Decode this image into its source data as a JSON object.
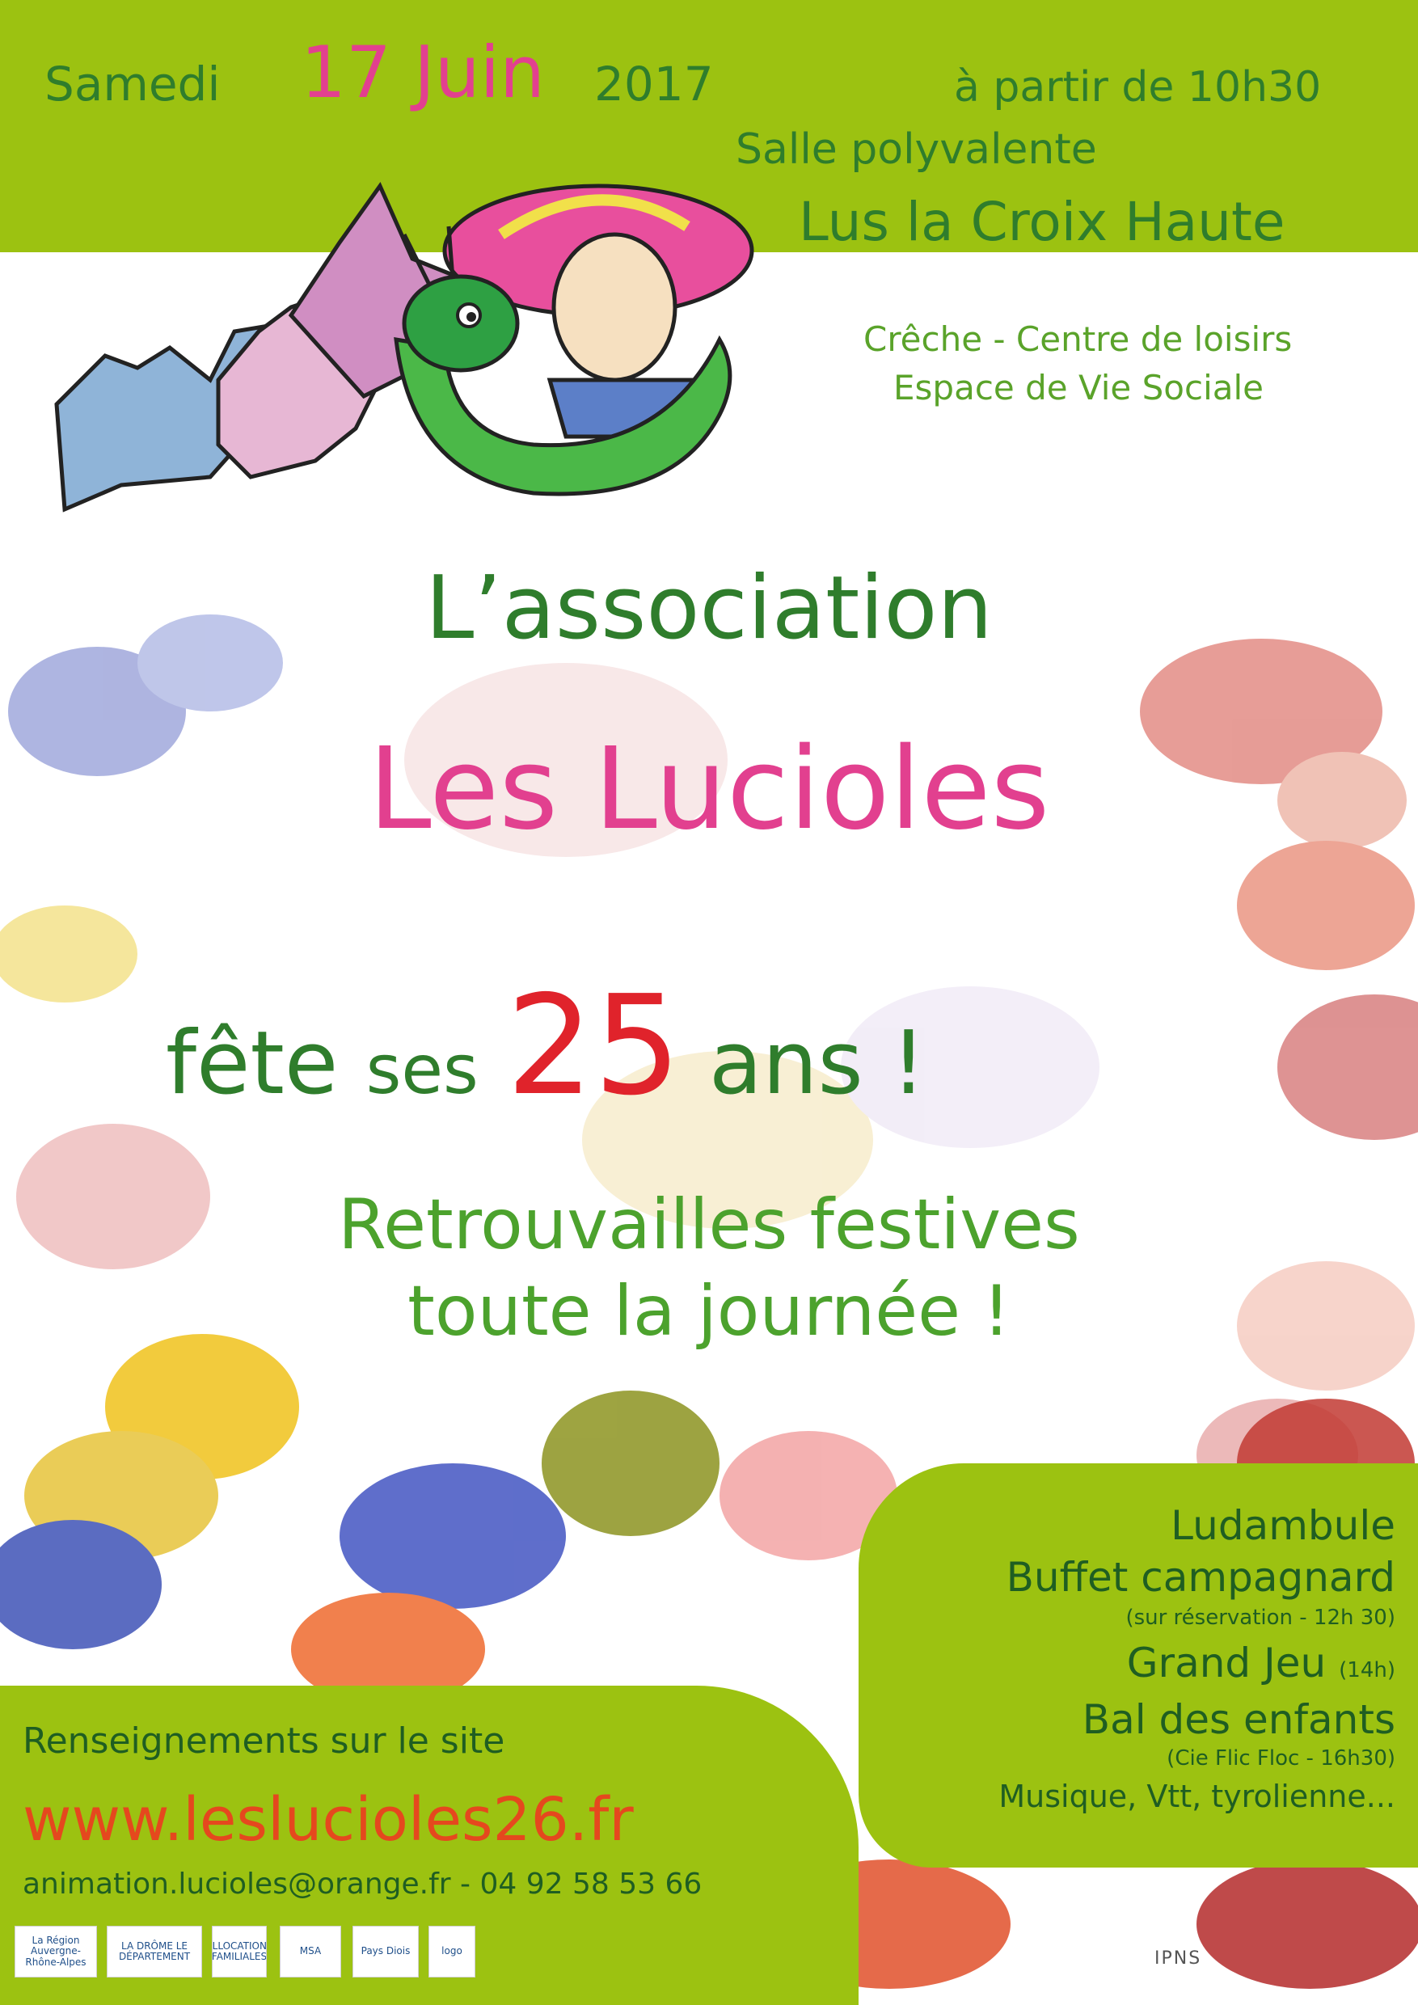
{
  "header": {
    "date_day": "Samedi",
    "date_num": "17 Juin",
    "date_year": "2017",
    "time": "à partir de 10h30",
    "venue": "Salle polyvalente",
    "town": "Lus la Croix Haute"
  },
  "services": {
    "line1": "Crêche - Centre de loisirs",
    "line2": "Espace de Vie Sociale"
  },
  "title": {
    "association": "L’association",
    "name": "Les Lucioles",
    "celebrate_a": "fête",
    "celebrate_b": "ses",
    "celebrate_num": "25",
    "celebrate_c": "ans !",
    "reunion_line1": "Retrouvailles festives",
    "reunion_line2": "toute la journée !"
  },
  "program": {
    "item1": "Ludambule",
    "item2": "Buffet campagnard",
    "item2_note": "(sur réservation - 12h 30)",
    "item3": "Grand Jeu",
    "item3_note": "(14h)",
    "item4": "Bal des enfants",
    "item4_note": "(Cie Flic Floc - 16h30)",
    "item5": "Musique, Vtt, tyrolienne..."
  },
  "info": {
    "label": "Renseignements sur le site",
    "url": "www.leslucioles26.fr",
    "contact": "animation.lucioles@orange.fr - 04 92 58 53 66"
  },
  "logos": [
    "La Région Auvergne-Rhône-Alpes",
    "LA DRÔME LE DÉPARTEMENT",
    "ALLOCATIONS FAMILIALES",
    "MSA",
    "Pays Diois",
    "logo"
  ],
  "footer": {
    "ipns": "IPNS"
  },
  "colors": {
    "lime": "#9cc211",
    "dark_green": "#2f7d2c",
    "pink": "#e2408f",
    "red": "#e0232b",
    "orange": "#e5481e"
  }
}
